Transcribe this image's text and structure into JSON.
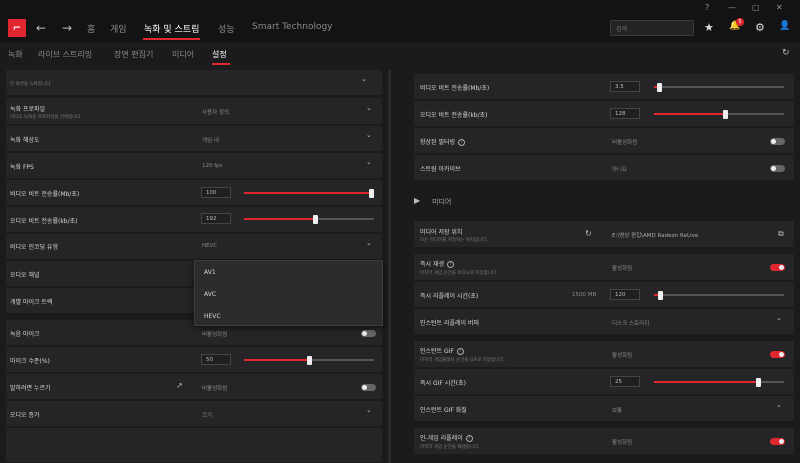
{
  "window": {
    "min": "—",
    "max": "▢",
    "close": "✕",
    "help": "?"
  },
  "nav": {
    "home": "홈",
    "games": "게임",
    "record": "녹화 및 스트림",
    "performance": "성능",
    "smart": "Smart Technology"
  },
  "search": {
    "placeholder": "검색"
  },
  "notifications": {
    "count": "5"
  },
  "subnav": {
    "record": "녹화",
    "live": "라이브 스트리밍",
    "scene": "장면 편집기",
    "media": "미디어",
    "settings": "설정"
  },
  "left": {
    "top_desc": "한 화면을 녹화합니다.",
    "rows": [
      {
        "label": "녹화 프로파일",
        "desc": "비디오 녹화용 프로파일을 선택합니다.",
        "value": "사용자 정의"
      },
      {
        "label": "녹화 해상도",
        "value": "게임 내"
      },
      {
        "label": "녹화 FPS",
        "value": "120 fps"
      },
      {
        "label": "비디오 비트 전송률(Mb/초)",
        "value": "100",
        "level": 1.0
      },
      {
        "label": "오디오 비트 전송률(kb/초)",
        "value": "192",
        "level": 0.55
      },
      {
        "label": "비디오 인코딩 유형",
        "value": "HEVC"
      },
      {
        "label": "오디오 채널"
      },
      {
        "label": "개별 마이크 트랙"
      },
      {
        "label": "녹음 마이크",
        "value": "비활성화됨",
        "toggle": false
      },
      {
        "label": "마이크 수준(%)",
        "value": "50",
        "level": 0.5
      },
      {
        "label": "말하려면 누르기",
        "value": "비활성화됨",
        "toggle": false
      },
      {
        "label": "오디오 증가",
        "value": "끄기"
      }
    ],
    "dropdown": [
      "AV1",
      "AVC",
      "HEVC"
    ]
  },
  "right": {
    "rows": [
      {
        "label": "비디오 비트 전송률(Mb/초)",
        "value": "3.5",
        "level": 0.04
      },
      {
        "label": "오디오 비트 전송률(kb/초)",
        "value": "128",
        "level": 0.55
      },
      {
        "label": "향상된 필터링",
        "value": "비활성화됨",
        "toggle": false
      },
      {
        "label": "스트림 아카이브",
        "value": "아니요",
        "toggle": false
      }
    ],
    "media_header": "미디어",
    "media_rows": [
      {
        "label": "미디어 저장 위치",
        "desc": "모든 미디어를 저장하는 위치입니다.",
        "value": "E:\\영상 편집\\AMD Radeon ReLive"
      },
      {
        "label": "즉시 재생",
        "desc": "마지막 게임 순간을 비디오로 저장합니다.",
        "value": "활성화됨",
        "toggle": true
      },
      {
        "label": "즉시 리플레이 시간(초)",
        "size": "1500 MB",
        "value": "120",
        "level": 0.05
      },
      {
        "label": "인스턴트 리플레이 버퍼",
        "value": "디스크 스토리지"
      },
      {
        "label": "인스턴트 GIF",
        "desc": "마지막 게임플레이 순간을 GIF로 저장합니다.",
        "value": "활성화됨",
        "toggle": true
      },
      {
        "label": "즉시 GIF 시간(초)",
        "value": "25",
        "level": 0.8
      },
      {
        "label": "인스턴트 GIF 화질",
        "value": "보통"
      },
      {
        "label": "인-게임 리플레이",
        "desc": "마지막 게임 순간을 재생합니다.",
        "value": "활성화됨",
        "toggle": true
      }
    ]
  },
  "colors": {
    "accent": "#e0262f",
    "bg": "#1b1b1d",
    "row": "#252527"
  },
  "icons": {
    "back": "←",
    "forward": "→",
    "star": "★",
    "bell": "🔔",
    "gear": "⚙",
    "user": "👤",
    "refresh": "↻",
    "chevron": "⌄",
    "media": "▶",
    "folder": "⧉",
    "share": "↗"
  }
}
